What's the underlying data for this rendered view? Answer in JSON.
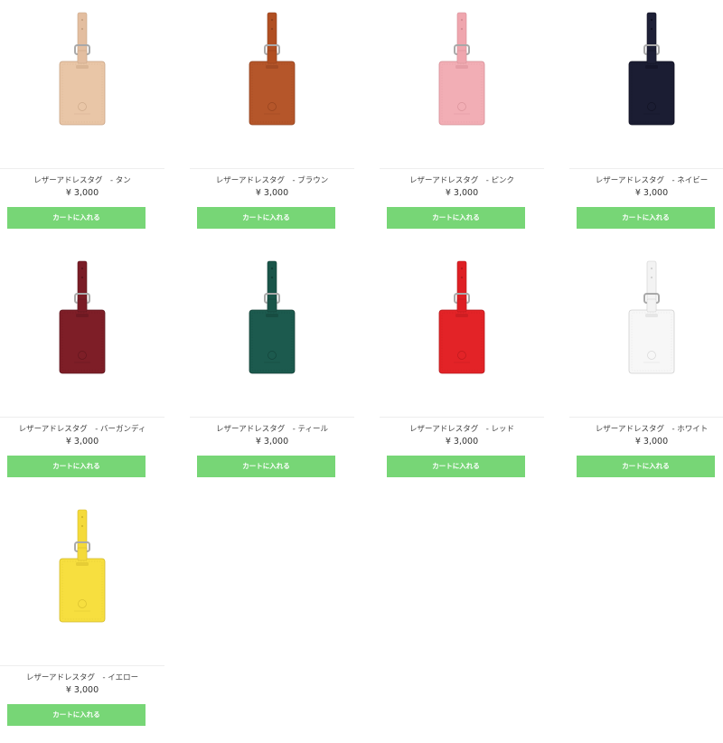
{
  "cart_label": "カートに入れる",
  "products": [
    {
      "name": "レザーアドレスタグ　- タン",
      "price": "¥ 3,000",
      "color": "#e9c6a7",
      "strap": "#e3bea0",
      "dark": "#c7a283"
    },
    {
      "name": "レザーアドレスタグ　- ブラウン",
      "price": "¥ 3,000",
      "color": "#b5562a",
      "strap": "#b04f22",
      "dark": "#8e3f1c"
    },
    {
      "name": "レザーアドレスタグ　- ピンク",
      "price": "¥ 3,000",
      "color": "#f2aeb5",
      "strap": "#efa6ae",
      "dark": "#d48c94"
    },
    {
      "name": "レザーアドレスタグ　- ネイビー",
      "price": "¥ 3,000",
      "color": "#1b1d33",
      "strap": "#1e2037",
      "dark": "#0f1020"
    },
    {
      "name": "レザーアドレスタグ　- バーガンディ",
      "price": "¥ 3,000",
      "color": "#7e1e27",
      "strap": "#7a1c26",
      "dark": "#5b141c"
    },
    {
      "name": "レザーアドレスタグ　- ティール",
      "price": "¥ 3,000",
      "color": "#1c5a4e",
      "strap": "#1a5549",
      "dark": "#123f36"
    },
    {
      "name": "レザーアドレスタグ　- レッド",
      "price": "¥ 3,000",
      "color": "#e32327",
      "strap": "#de1f24",
      "dark": "#b3191c"
    },
    {
      "name": "レザーアドレスタグ　- ホワイト",
      "price": "¥ 3,000",
      "color": "#f7f7f7",
      "strap": "#f3f3f3",
      "dark": "#d0d0d0"
    },
    {
      "name": "レザーアドレスタグ　- イエロー",
      "price": "¥ 3,000",
      "color": "#f7df3f",
      "strap": "#f4da3a",
      "dark": "#d1b82a"
    }
  ]
}
